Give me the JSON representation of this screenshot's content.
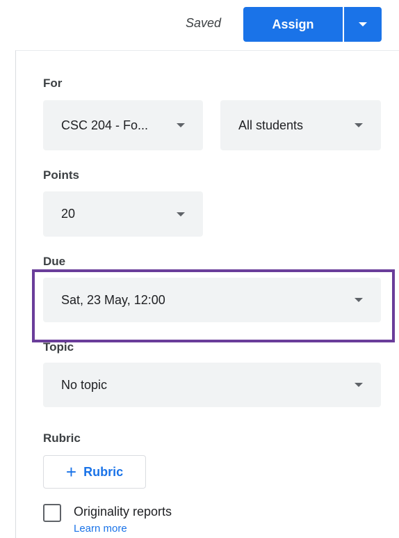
{
  "header": {
    "status": "Saved",
    "assign_label": "Assign"
  },
  "for": {
    "label": "For",
    "class_value": "CSC 204 - Fo...",
    "students_value": "All students"
  },
  "points": {
    "label": "Points",
    "value": "20"
  },
  "due": {
    "label": "Due",
    "value": "Sat, 23 May, 12:00"
  },
  "topic": {
    "label": "Topic",
    "value": "No topic"
  },
  "rubric": {
    "label": "Rubric",
    "button_label": "Rubric",
    "button_icon": "plus-icon"
  },
  "originality": {
    "label": "Originality reports",
    "learn_more": "Learn more"
  },
  "colors": {
    "primary": "#1a73e8",
    "highlight": "#6a3d9a",
    "field_bg": "#f1f3f4"
  }
}
